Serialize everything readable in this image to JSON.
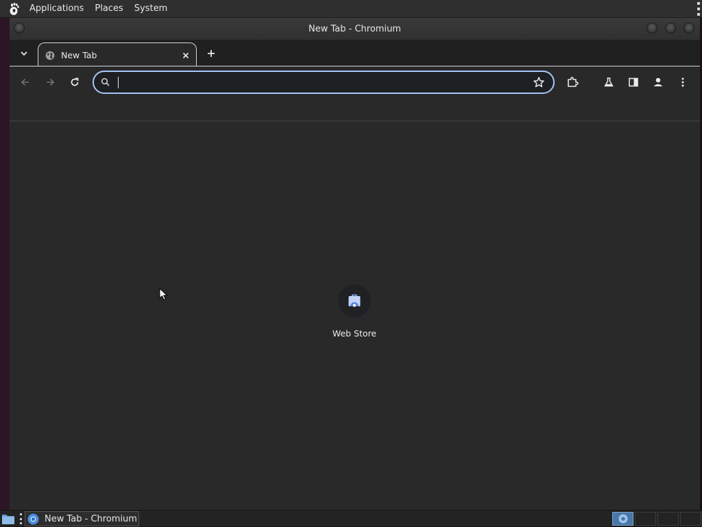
{
  "top_panel": {
    "menus": [
      "Applications",
      "Places",
      "System"
    ]
  },
  "window": {
    "title": "New Tab - Chromium"
  },
  "tabs": [
    {
      "title": "New Tab",
      "active": true
    }
  ],
  "toolbar": {
    "omnibox_value": "",
    "icons": [
      "back-icon",
      "forward-icon",
      "reload-icon",
      "search-icon",
      "bookmark-star-icon",
      "extensions-icon",
      "labs-flask-icon",
      "side-panel-icon",
      "profile-icon",
      "menu-kebab-icon"
    ]
  },
  "content": {
    "shortcuts": [
      {
        "label": "Web Store",
        "icon": "web-store-icon"
      }
    ]
  },
  "taskbar": {
    "tasks": [
      {
        "label": "New Tab - Chromium",
        "icon": "chromium-icon"
      }
    ]
  },
  "colors": {
    "omnibox_border": "#a8c7fa",
    "page_background": "#292929",
    "tabstrip_background": "#202020",
    "workspace_active": "#4a78a6"
  }
}
